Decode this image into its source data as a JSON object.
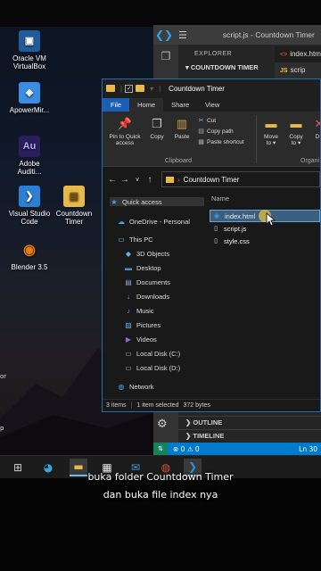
{
  "desktop": {
    "icons": [
      {
        "label": "Oracle VM\nVirtualBox",
        "glyph": "▣",
        "color": "#1f5c99"
      },
      {
        "label": "ApowerMir...",
        "glyph": "◈",
        "color": "#3a8de0"
      },
      {
        "label": "Adobe\nAuditi...",
        "glyph": "Au",
        "color": "#2a1f5a"
      },
      {
        "label": "Visual Studio\nCode",
        "glyph": "❯",
        "color": "#2b7fd4"
      },
      {
        "label": "Countdown\nTimer",
        "glyph": "▤",
        "color": "#e8b84a"
      },
      {
        "label": "Blender 3.5",
        "glyph": "◉",
        "color": "#e87d0d"
      }
    ],
    "edge_fragments": [
      "or",
      "p"
    ]
  },
  "vscode": {
    "title": "script.js - Countdown Timer",
    "sidebar_header": "EXPLORER",
    "folder_section": "COUNTDOWN TIMER",
    "tabs": [
      {
        "badge": "<>",
        "name": "index.htm"
      },
      {
        "badge": "JS",
        "name": "scrip"
      }
    ],
    "outline_label": "OUTLINE",
    "timeline_label": "TIMELINE",
    "status_errors": "⊗ 0 ⚠ 0",
    "status_position": "Ln 30"
  },
  "explorer": {
    "title": "Countdown Timer",
    "ribbon_tabs": [
      "File",
      "Home",
      "Share",
      "View"
    ],
    "ribbon": {
      "pin_label": "Pin to Quick\naccess",
      "copy_label": "Copy",
      "paste_label": "Paste",
      "cut_label": "Cut",
      "copy_path_label": "Copy path",
      "paste_shortcut_label": "Paste shortcut",
      "clipboard_group": "Clipboard",
      "move_to_label": "Move\nto ▾",
      "copy_to_label": "Copy\nto ▾",
      "organize_group": "Organi",
      "delete_label": "D"
    },
    "address": "Countdown Timer",
    "nav": [
      {
        "label": "Quick access",
        "icon": "★",
        "color": "#4aa3ea"
      },
      {
        "label": "OneDrive - Personal",
        "icon": "☁",
        "color": "#4aa3ea"
      },
      {
        "label": "This PC",
        "icon": "▭",
        "color": "#6cb8f0"
      },
      {
        "label": "3D Objects",
        "icon": "◆",
        "color": "#5fb3e8"
      },
      {
        "label": "Desktop",
        "icon": "▬",
        "color": "#4a8fd8"
      },
      {
        "label": "Documents",
        "icon": "▤",
        "color": "#8aa8c8"
      },
      {
        "label": "Downloads",
        "icon": "↓",
        "color": "#4aa3ea"
      },
      {
        "label": "Music",
        "icon": "♪",
        "color": "#4aa3ea"
      },
      {
        "label": "Pictures",
        "icon": "▨",
        "color": "#5fb3e8"
      },
      {
        "label": "Videos",
        "icon": "▶",
        "color": "#8a6ad8"
      },
      {
        "label": "Local Disk (C:)",
        "icon": "▭",
        "color": "#aaa"
      },
      {
        "label": "Local Disk (D:)",
        "icon": "▭",
        "color": "#aaa"
      },
      {
        "label": "Network",
        "icon": "◍",
        "color": "#4aa3ea"
      }
    ],
    "column_name": "Name",
    "files": [
      {
        "name": "index.html",
        "icon": "◉",
        "color": "#3a9be0",
        "selected": true
      },
      {
        "name": "script.js",
        "icon": "▯",
        "color": "#ddd",
        "selected": false
      },
      {
        "name": "style.css",
        "icon": "▯",
        "color": "#ddd",
        "selected": false
      }
    ],
    "status": {
      "items": "3 items",
      "selected": "1 item selected",
      "size": "372 bytes"
    }
  },
  "taskbar": {
    "items": [
      {
        "name": "task-view",
        "glyph": "⊞",
        "color": "#ccc"
      },
      {
        "name": "edge",
        "glyph": "◕",
        "color": "#2fa8e0"
      },
      {
        "name": "file-explorer",
        "glyph": "▬",
        "color": "#e8b84a"
      },
      {
        "name": "store",
        "glyph": "▦",
        "color": "#e8e8e8"
      },
      {
        "name": "mail",
        "glyph": "✉",
        "color": "#3a9be0"
      },
      {
        "name": "chrome",
        "glyph": "◍",
        "color": "#e04a3a"
      },
      {
        "name": "vscode",
        "glyph": "❯",
        "color": "#2b8fd8"
      }
    ]
  },
  "captions": {
    "line1": "buka folder Countdown Timer",
    "line2": "dan buka file index nya"
  }
}
